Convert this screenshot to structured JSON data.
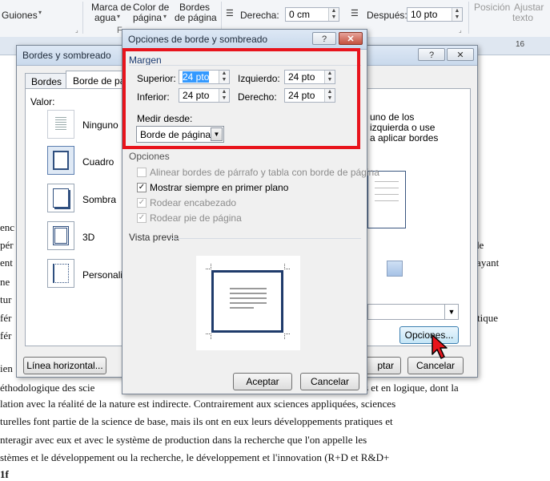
{
  "ribbon": {
    "guiones": "Guiones",
    "marca_agua_1": "Marca de",
    "marca_agua_2": "agua",
    "color_pagina_1": "Color de",
    "color_pagina_2": "página",
    "bordes_pagina_1": "Bordes",
    "bordes_pagina_2": "de página",
    "derecha_label": "Derecha:",
    "derecha_value": "0 cm",
    "despues_label": "Después:",
    "despues_value": "10 pto",
    "posicion": "Posición",
    "ajustar_1": "Ajustar",
    "ajustar_2": "texto",
    "group_fondo": "F",
    "ruler_mark": "16"
  },
  "document": {
    "lines": [
      "enc",
      "pér",
      "ent",
      "ne",
      "tur",
      "fér",
      "fér",
      "ien",
      "éthodologique des scie",
      "lation avec la réalité de la nature est indirecte. Contrairement aux sciences appliquées, sciences",
      "turelles font partie de la science de base, mais ils ont en eux leurs développements pratiques et",
      "nteragir avec eux et avec le système de production dans la recherche que l'on appelle les",
      "stèmes et le développement ou la recherche, le développement et l'innovation (R+D et R&D+",
      "1f"
    ],
    "right_fragments": {
      "de": "de",
      "sayant": "sayant",
      "tique": "tique",
      "logique": "s et en logique, dont la"
    }
  },
  "back_dialog": {
    "title": "Bordes y sombreado",
    "help": "?",
    "close": "✕",
    "tabs": [
      "Bordes",
      "Borde de pá"
    ],
    "valor_label": "Valor:",
    "settings": [
      "Ninguno",
      "Cuadro",
      "Sombra",
      "3D",
      "Personalizado"
    ],
    "hint_lines": [
      "uno de los",
      "izquierda o use",
      "a aplicar bordes"
    ],
    "linea_horizontal": "Línea horizontal...",
    "opciones": "Opciones...",
    "aceptar_partial": "ptar",
    "cancelar": "Cancelar"
  },
  "front_dialog": {
    "title": "Opciones de borde y sombreado",
    "help": "?",
    "close": "✕",
    "margen_title": "Margen",
    "superior_label": "Superior:",
    "superior_value": "24 pto",
    "izquierdo_label": "Izquierdo:",
    "izquierdo_value": "24 pto",
    "inferior_label": "Inferior:",
    "inferior_value": "24 pto",
    "derecho_label": "Derecho:",
    "derecho_value": "24 pto",
    "medir_label": "Medir desde:",
    "medir_value": "Borde de página",
    "opciones_title": "Opciones",
    "opt_alinear": "Alinear bordes de párrafo y tabla con borde de página",
    "opt_mostrar": "Mostrar siempre en primer plano",
    "opt_encabezado": "Rodear encabezado",
    "opt_pie": "Rodear pie de página",
    "vista_previa": "Vista previa",
    "aceptar": "Aceptar",
    "cancelar": "Cancelar"
  },
  "colors": {
    "highlight": "#e8141c",
    "accent": "#1f3b6b"
  }
}
